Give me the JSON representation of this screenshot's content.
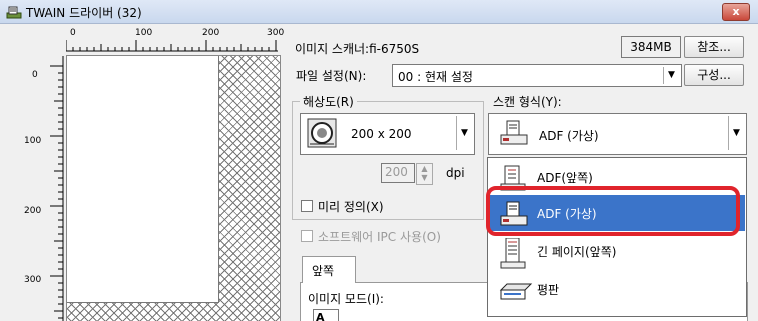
{
  "window": {
    "title": "TWAIN 드라이버 (32)",
    "close_label": "x"
  },
  "ruler": {
    "top_ticks": [
      "0",
      "100",
      "200",
      "300"
    ],
    "left_ticks": [
      "0",
      "100",
      "200",
      "300"
    ]
  },
  "scanner": {
    "label": "이미지 스캐너:fi-6750S",
    "memory": "384MB",
    "ref_button": "참조..."
  },
  "file_settings": {
    "label": "파일 설정(N):",
    "value": "00 : 현재 설정",
    "config_button": "구성..."
  },
  "resolution": {
    "group_label": "해상도(R)",
    "value": "200 x 200",
    "dpi_value": "200",
    "dpi_unit": "dpi"
  },
  "scan_type": {
    "label": "스캔 형식(Y):",
    "value": "ADF (가상)",
    "options": [
      "ADF(앞쪽)",
      "ADF (가상)",
      "긴 페이지(앞쪽)",
      "평판"
    ],
    "selected_index": 1
  },
  "predefined": {
    "label": "미리 정의(X)"
  },
  "ipc": {
    "label": "소프트웨어 IPC 사용(O)"
  },
  "tabs": {
    "front": "앞쪽"
  },
  "image_mode": {
    "label": "이미지 모드(I):"
  },
  "colors": {
    "highlight": "#e0242c",
    "selection": "#3b74c9"
  }
}
